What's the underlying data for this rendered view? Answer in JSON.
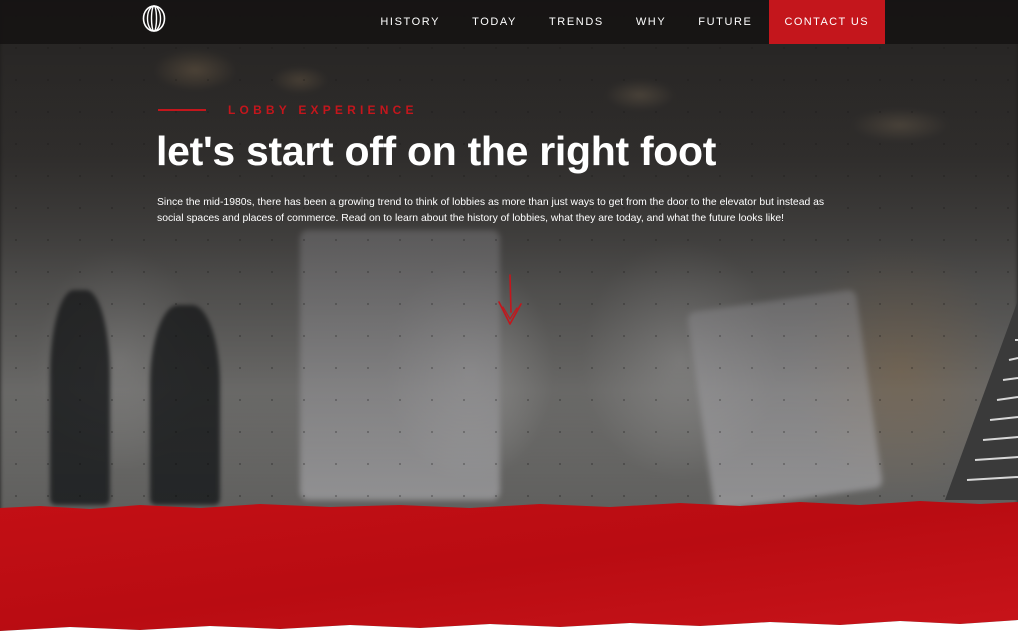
{
  "nav": {
    "logo_icon": "jll-logo-icon",
    "items": [
      {
        "label": "HISTORY"
      },
      {
        "label": "TODAY"
      },
      {
        "label": "TRENDS"
      },
      {
        "label": "WHY"
      },
      {
        "label": "FUTURE"
      }
    ],
    "contact_label": "CONTACT US"
  },
  "hero": {
    "eyebrow": "LOBBY EXPERIENCE",
    "headline": "let's start off on the right foot",
    "intro_line1": "Since the mid-1980s, there has been a growing trend to think of lobbies as more than just ways to get from the door to the elevator but instead as",
    "intro_line2": "social spaces and places of commerce. Read on to learn about the history of lobbies, what they are today, and what the future looks like!",
    "scroll_icon": "arrow-down-icon"
  },
  "colors": {
    "accent": "#c4161c",
    "nav_bg": "#161414",
    "text": "#ffffff"
  }
}
